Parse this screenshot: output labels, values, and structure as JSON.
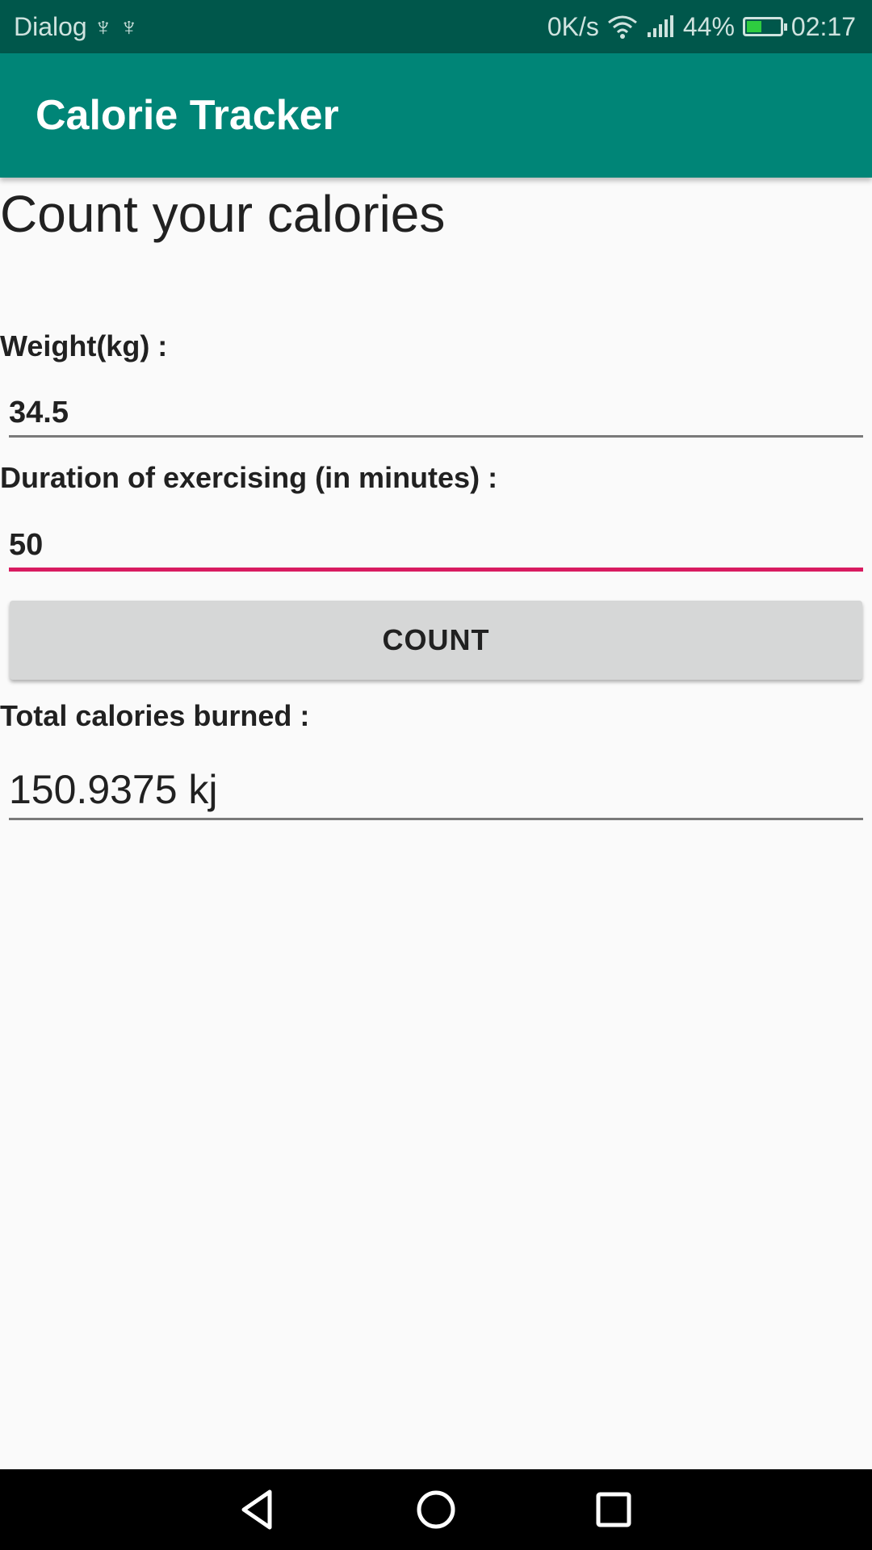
{
  "status_bar": {
    "carrier": "Dialog",
    "usb_icons": [
      "usb-icon",
      "usb-icon"
    ],
    "net_speed": "0K/s",
    "battery_percent": "44%",
    "battery_level": 0.44,
    "time": "02:17"
  },
  "app_bar": {
    "title": "Calorie Tracker"
  },
  "main": {
    "heading": "Count your calories",
    "weight_label": "Weight(kg) :",
    "weight_value": "34.5",
    "duration_label": "Duration of exercising (in minutes) :",
    "duration_value": "50",
    "count_button": "COUNT",
    "result_label": "Total calories burned :",
    "result_value": "150.9375 kj"
  },
  "colors": {
    "status_bar": "#00574b",
    "app_bar": "#008577",
    "accent": "#d81b60"
  },
  "nav_bar": {
    "icons": [
      "back-icon",
      "home-icon",
      "recents-icon"
    ]
  }
}
